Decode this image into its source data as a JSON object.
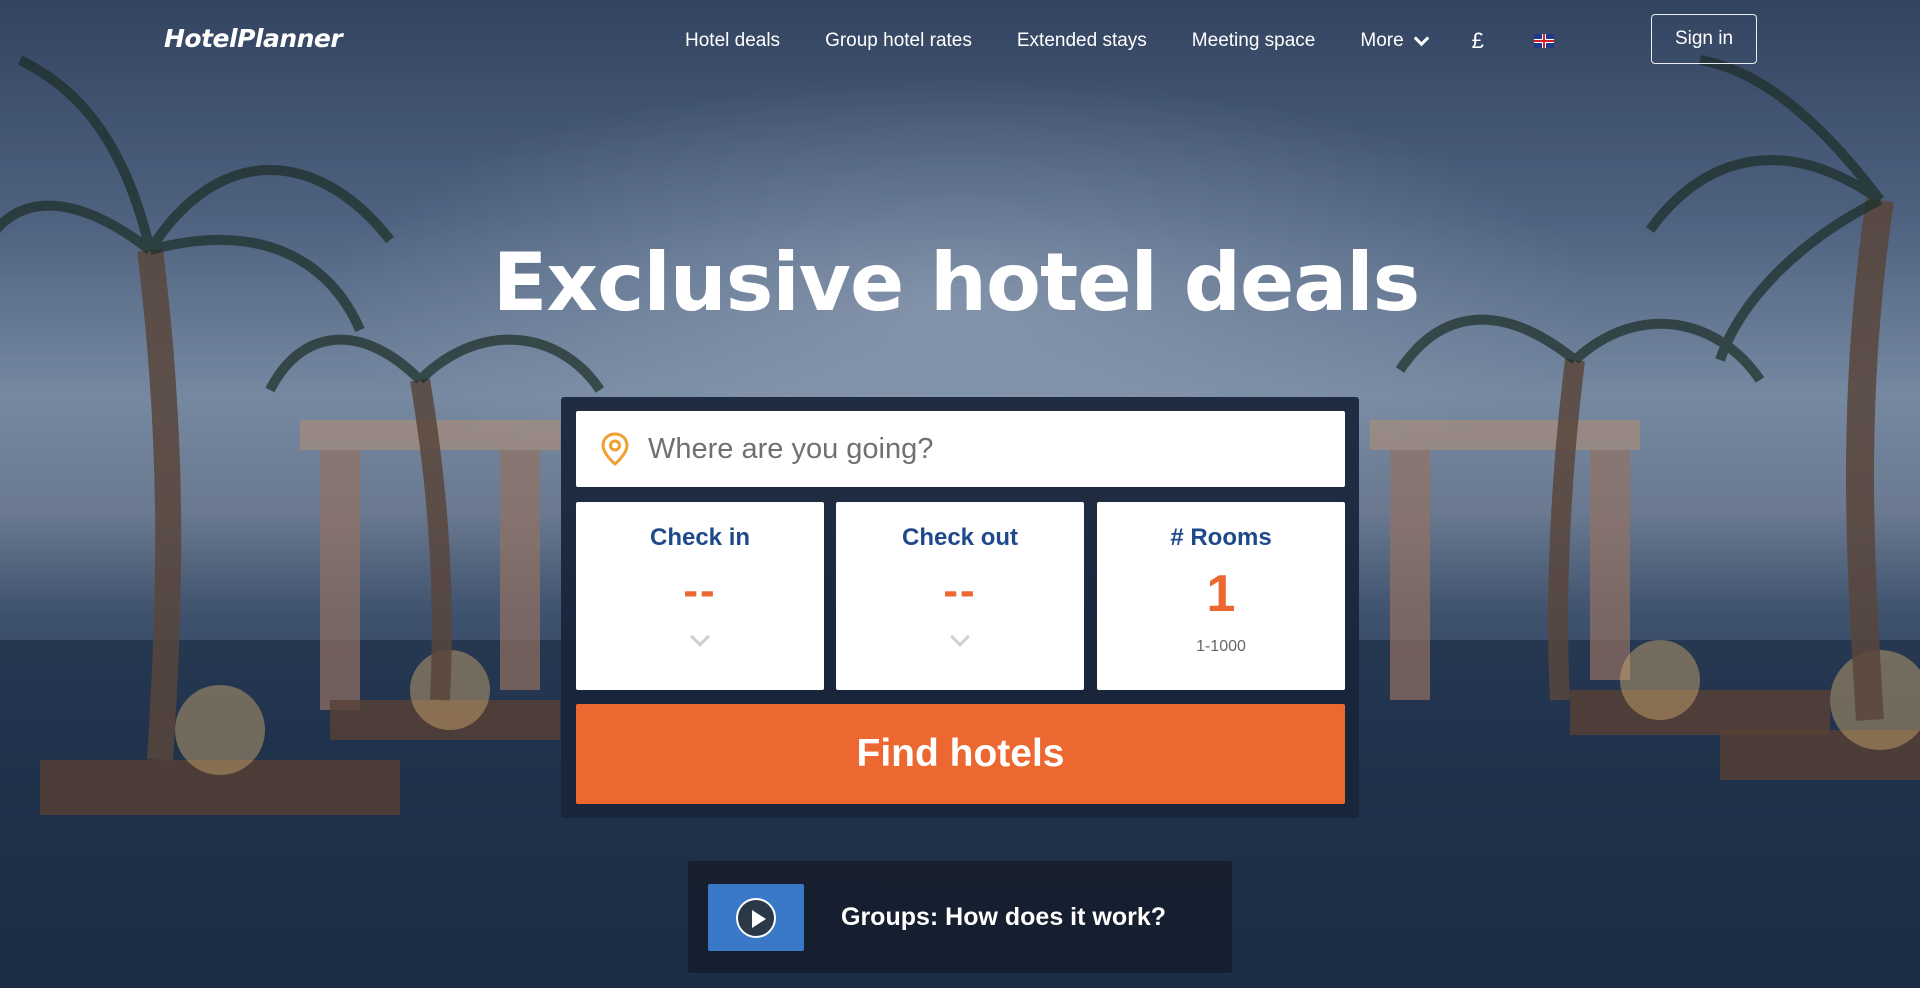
{
  "brand": {
    "logo": "HotelPlanner"
  },
  "nav": {
    "items": [
      {
        "label": "Hotel deals"
      },
      {
        "label": "Group hotel rates"
      },
      {
        "label": "Extended stays"
      },
      {
        "label": "Meeting space"
      },
      {
        "label": "More"
      }
    ],
    "currency": "£",
    "language_icon": "uk-flag-icon",
    "signin_label": "Sign in"
  },
  "hero": {
    "headline": "Exclusive hotel deals"
  },
  "search": {
    "destination_placeholder": "Where are you going?",
    "check_in": {
      "label": "Check in",
      "value": "--"
    },
    "check_out": {
      "label": "Check out",
      "value": "--"
    },
    "rooms": {
      "label": "# Rooms",
      "value": "1",
      "range": "1-1000"
    },
    "submit_label": "Find hotels"
  },
  "groups": {
    "label": "Groups: How does it work?"
  },
  "colors": {
    "accent": "#ec6830",
    "label_blue": "#1e4a8c",
    "panel": "#18243a"
  }
}
